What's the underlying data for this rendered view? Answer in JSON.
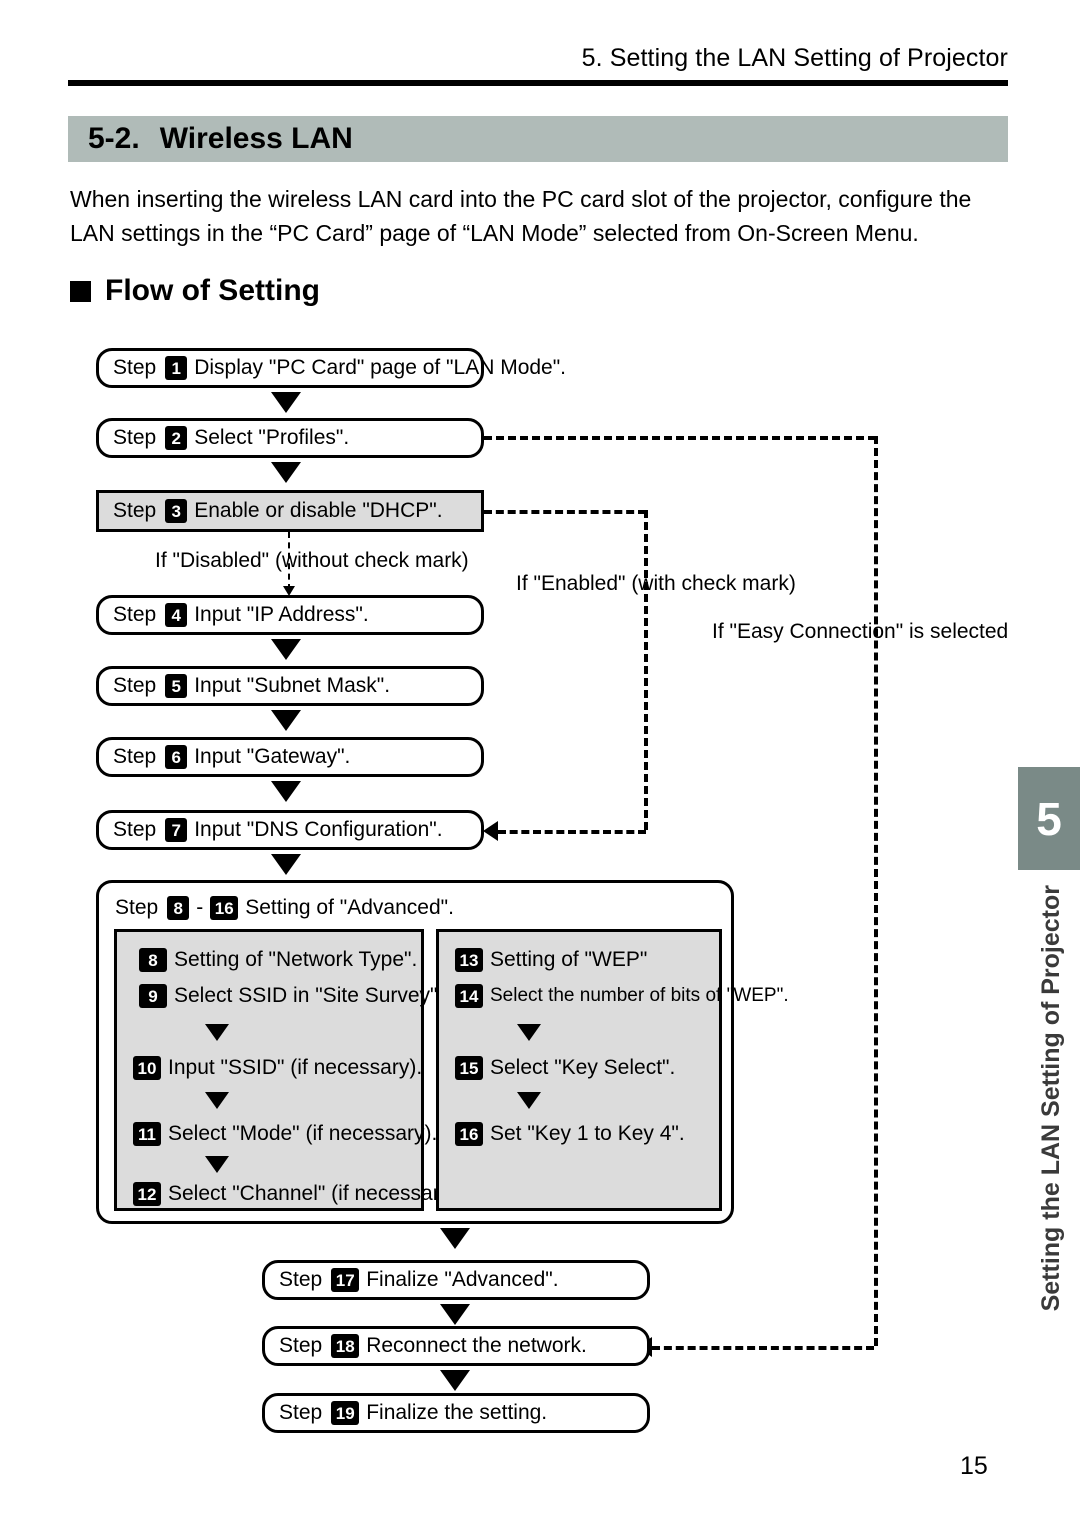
{
  "header": {
    "running_head": "5. Setting the LAN Setting of Projector"
  },
  "section": {
    "number": "5-2.",
    "title": "Wireless LAN"
  },
  "intro": "When inserting the wireless LAN card into the PC card slot of the projector, configure the LAN settings in the “PC Card” page of “LAN Mode” selected from On-Screen Menu.",
  "flow_heading": "Flow of Setting",
  "flow": {
    "step_label": "Step",
    "dash": "-",
    "steps": [
      {
        "num": "1",
        "text": "Display \"PC Card\" page of \"LAN Mode\"."
      },
      {
        "num": "2",
        "text": "Select \"Profiles\"."
      },
      {
        "num": "3",
        "text": "Enable or disable \"DHCP\"."
      },
      {
        "num": "4",
        "text": "Input \"IP Address\"."
      },
      {
        "num": "5",
        "text": "Input \"Subnet Mask\"."
      },
      {
        "num": "6",
        "text": "Input \"Gateway\"."
      },
      {
        "num": "7",
        "text": "Input \"DNS Configuration\"."
      },
      {
        "num": "17",
        "text": "Finalize \"Advanced\"."
      },
      {
        "num": "18",
        "text": "Reconnect the network."
      },
      {
        "num": "19",
        "text": "Finalize the setting."
      }
    ],
    "branch_labels": {
      "disabled": "If \"Disabled\" (without check mark)",
      "enabled": "If \"Enabled\" (with check mark)",
      "easy": "If \"Easy Connection\" is selected"
    },
    "advanced": {
      "range_start": "8",
      "range_end": "16",
      "title_text": "Setting of \"Advanced\".",
      "left_panel": [
        {
          "num": "8",
          "text": "Setting of \"Network Type\"."
        },
        {
          "num": "9",
          "text": "Select SSID in \"Site Survey\"."
        },
        {
          "num": "10",
          "text": "Input \"SSID\" (if necessary)."
        },
        {
          "num": "11",
          "text": "Select \"Mode\" (if necessary)."
        },
        {
          "num": "12",
          "text": "Select \"Channel\" (if necessary)."
        }
      ],
      "right_panel": [
        {
          "num": "13",
          "text": "Setting of \"WEP\""
        },
        {
          "num": "14",
          "text": "Select the number of bits of \"WEP\"."
        },
        {
          "num": "15",
          "text": "Select \"Key Select\"."
        },
        {
          "num": "16",
          "text": "Set \"Key 1 to Key 4\"."
        }
      ]
    }
  },
  "side_tab": {
    "chapter": "5",
    "label": "Setting the LAN Setting of Projector",
    "color": "#7a8a87"
  },
  "page_number": "15",
  "colors": {
    "section_bar": "#b0bbb8",
    "shaded_box": "#dcdcdc",
    "rule": "#000000"
  }
}
